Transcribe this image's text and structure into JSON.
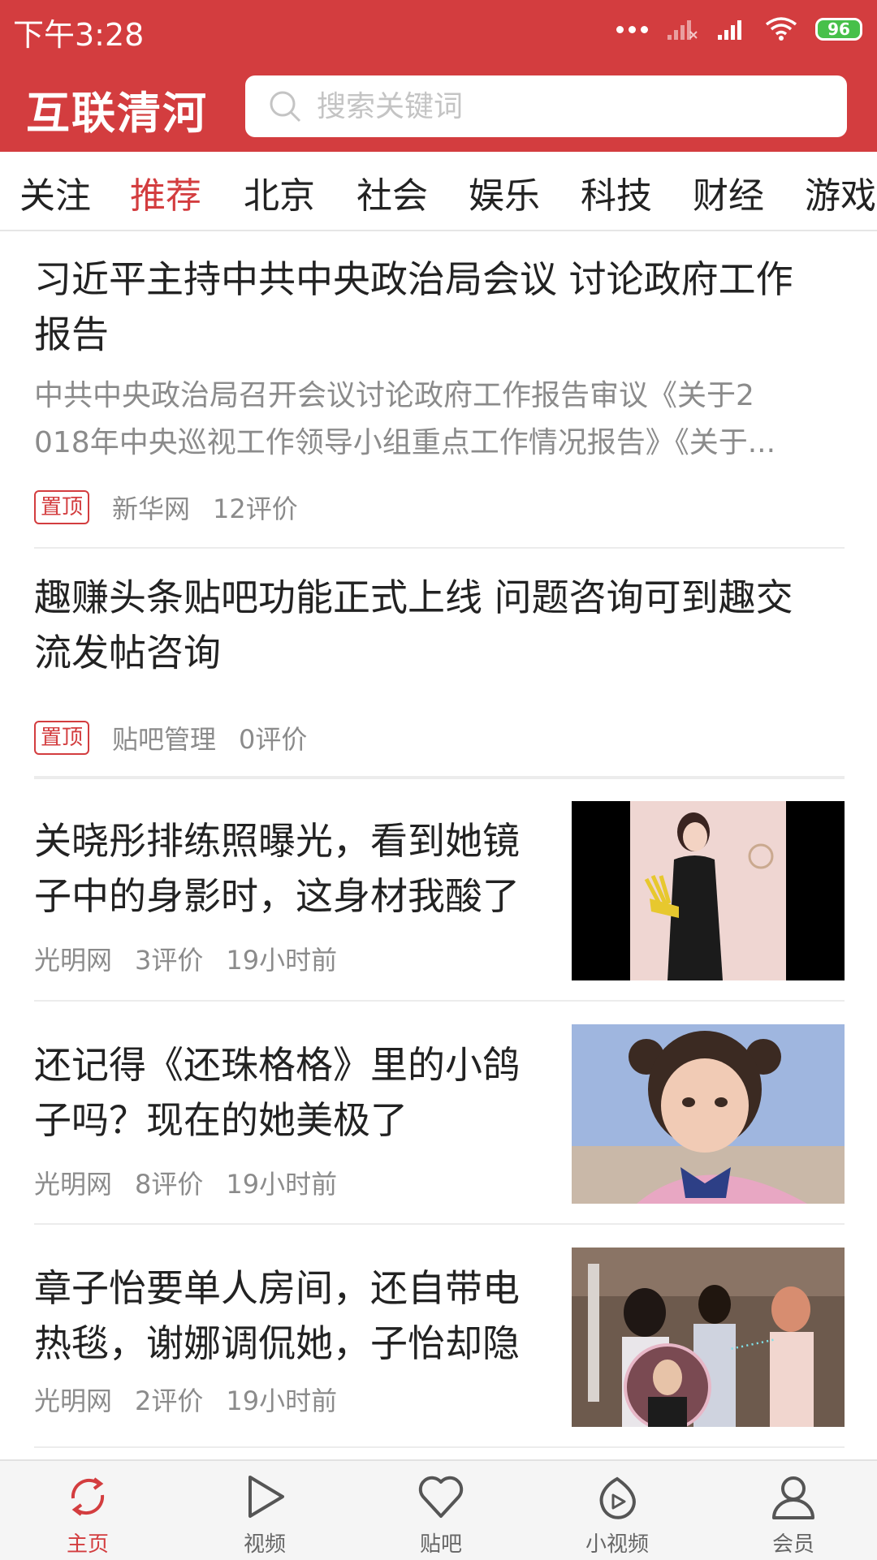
{
  "status_bar": {
    "time": "下午3:28",
    "battery": "96",
    "battery_color": "#47c04a"
  },
  "header": {
    "title": "互联清河",
    "search_placeholder": "搜索关键词",
    "background_color": "#d33d3f"
  },
  "tabs": [
    {
      "label": "关注"
    },
    {
      "label": "推荐",
      "active": true
    },
    {
      "label": "北京"
    },
    {
      "label": "社会"
    },
    {
      "label": "娱乐"
    },
    {
      "label": "科技"
    },
    {
      "label": "财经"
    },
    {
      "label": "游戏"
    }
  ],
  "articles": [
    {
      "title_line1": "习近平主持中共中央政治局会议 讨论政府工作",
      "title_line2": "报告",
      "summary_line1": "中共中央政治局召开会议讨论政府工作报告审议《关于2",
      "summary_line2": "018年中央巡视工作领导小组重点工作情况报告》《关于...",
      "pin": "置顶",
      "source": "新华网",
      "comments": "12评价"
    },
    {
      "title_line1": "趣赚头条贴吧功能正式上线 问题咨询可到趣交",
      "title_line2": "流发帖咨询",
      "pin": "置顶",
      "source": "贴吧管理",
      "comments": "0评价"
    },
    {
      "title_line1": "关晓彤排练照曝光，看到她镜",
      "title_line2": "子中的身影时，这身材我酸了",
      "source": "光明网",
      "comments": "3评价",
      "time": "19小时前"
    },
    {
      "title_line1": "还记得《还珠格格》里的小鸽",
      "title_line2": "子吗？现在的她美极了",
      "source": "光明网",
      "comments": "8评价",
      "time": "19小时前"
    },
    {
      "title_line1": "章子怡要单人房间，还自带电",
      "title_line2": "热毯，谢娜调侃她，子怡却隐",
      "source": "光明网",
      "comments": "2评价",
      "time": "19小时前"
    }
  ],
  "bottom_nav": [
    {
      "label": "主页",
      "icon": "refresh-icon",
      "active": true
    },
    {
      "label": "视频",
      "icon": "play-icon"
    },
    {
      "label": "贴吧",
      "icon": "heart-icon"
    },
    {
      "label": "小视频",
      "icon": "short-video-icon"
    },
    {
      "label": "会员",
      "icon": "user-icon"
    }
  ]
}
